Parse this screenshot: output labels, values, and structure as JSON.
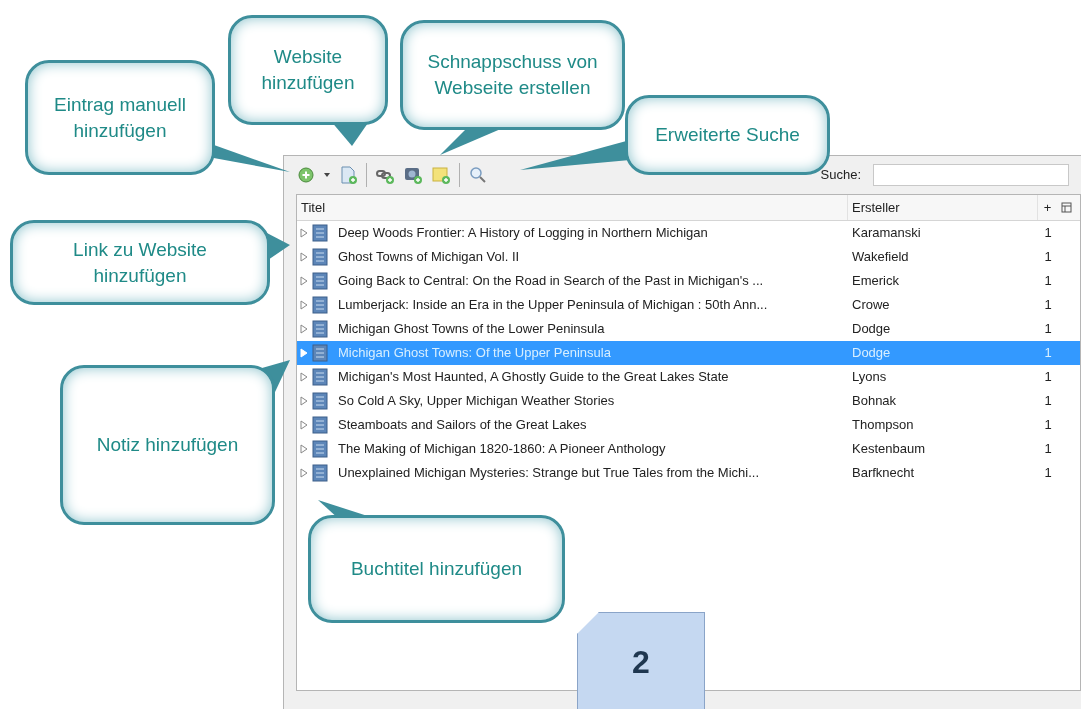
{
  "callouts": [
    {
      "text": "Eintrag manuell hinzufügen"
    },
    {
      "text": "Website hinzufügen"
    },
    {
      "text": "Schnappschuss von Webseite erstellen"
    },
    {
      "text": "Erweiterte Suche"
    },
    {
      "text": "Link zu Website hinzufügen"
    },
    {
      "text": "Notiz hinzufügen"
    },
    {
      "text": "Buchtitel hinzufügen"
    }
  ],
  "page_note": "2",
  "search": {
    "label": "Suche:"
  },
  "table": {
    "columns": [
      "Titel",
      "Ersteller",
      "+"
    ],
    "rows": [
      {
        "title": "Deep Woods Frontier: A History of Logging in Northern Michigan",
        "creator": "Karamanski",
        "count": "1",
        "selected": false
      },
      {
        "title": "Ghost Towns of Michigan Vol. II",
        "creator": "Wakefield",
        "count": "1",
        "selected": false
      },
      {
        "title": "Going Back to Central: On the Road in Search of the Past in Michigan's ...",
        "creator": "Emerick",
        "count": "1",
        "selected": false
      },
      {
        "title": "Lumberjack: Inside an Era in the Upper Peninsula of Michigan : 50th Ann...",
        "creator": "Crowe",
        "count": "1",
        "selected": false
      },
      {
        "title": "Michigan Ghost Towns of the Lower Peninsula",
        "creator": "Dodge",
        "count": "1",
        "selected": false
      },
      {
        "title": "Michigan Ghost Towns: Of the Upper Peninsula",
        "creator": "Dodge",
        "count": "1",
        "selected": true
      },
      {
        "title": "Michigan's Most Haunted, A Ghostly Guide to the Great Lakes State",
        "creator": "Lyons",
        "count": "1",
        "selected": false
      },
      {
        "title": "So Cold A Sky, Upper Michigan Weather Stories",
        "creator": "Bohnak",
        "count": "1",
        "selected": false
      },
      {
        "title": "Steamboats and Sailors of the Great Lakes",
        "creator": "Thompson",
        "count": "1",
        "selected": false
      },
      {
        "title": "The Making of Michigan 1820-1860: A Pioneer Anthology",
        "creator": "Kestenbaum",
        "count": "1",
        "selected": false
      },
      {
        "title": "Unexplained Michigan Mysteries: Strange but True Tales from the Michi...",
        "creator": "Barfknecht",
        "count": "1",
        "selected": false
      }
    ]
  }
}
